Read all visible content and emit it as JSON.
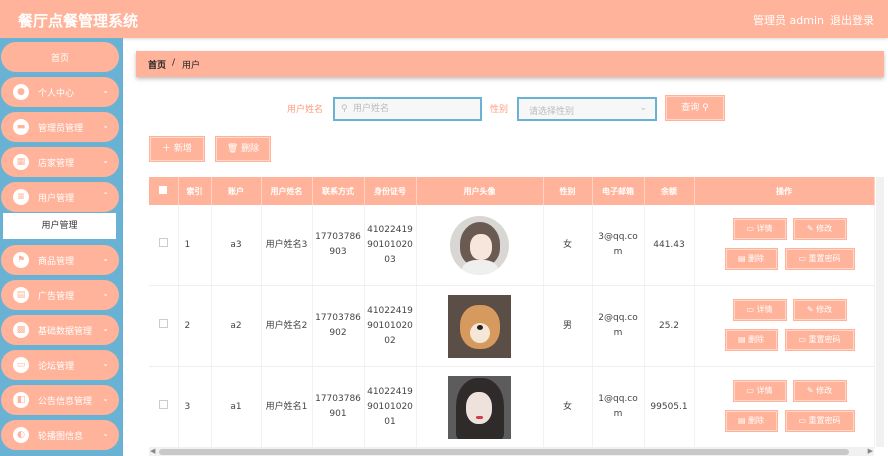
{
  "header": {
    "title": "餐厅点餐管理系统",
    "admin": "管理员 admin",
    "logout": "退出登录"
  },
  "sidebar": {
    "home": "首页",
    "items": [
      {
        "label": "个人中心",
        "icon": "user-icon"
      },
      {
        "label": "管理员管理",
        "icon": "admin-icon"
      },
      {
        "label": "店家管理",
        "icon": "store-icon"
      },
      {
        "label": "用户管理",
        "icon": "users-icon"
      },
      {
        "label": "商品管理",
        "icon": "goods-icon"
      },
      {
        "label": "广告管理",
        "icon": "ad-icon"
      },
      {
        "label": "基础数据管理",
        "icon": "grid-icon"
      },
      {
        "label": "论坛管理",
        "icon": "forum-icon"
      },
      {
        "label": "公告信息管理",
        "icon": "notice-icon"
      },
      {
        "label": "轮播图信息",
        "icon": "carousel-icon"
      }
    ],
    "active_sub": "用户管理"
  },
  "breadcrumb": {
    "home": "首页",
    "sep": "/",
    "current": "用户"
  },
  "search": {
    "name_label": "用户姓名",
    "name_placeholder": "用户姓名",
    "sex_label": "性别",
    "sex_placeholder": "请选择性别",
    "query_label": "查询"
  },
  "toolbar": {
    "add_label": "新增",
    "delete_label": "删除"
  },
  "table": {
    "headers": [
      "索引",
      "账户",
      "用户姓名",
      "联系方式",
      "身份证号",
      "用户头像",
      "性别",
      "电子邮箱",
      "余额",
      "操作"
    ],
    "rows": [
      {
        "index": "1",
        "account": "a3",
        "name": "用户姓名3",
        "phone": "17703786903",
        "idcard": "410224199010102003",
        "avatar": "avatar-illustrated-girl",
        "sex": "女",
        "email": "3@qq.com",
        "balance": "441.43"
      },
      {
        "index": "2",
        "account": "a2",
        "name": "用户姓名2",
        "phone": "17703786902",
        "idcard": "410224199010102002",
        "avatar": "avatar-shiba-dog",
        "sex": "男",
        "email": "2@qq.com",
        "balance": "25.2"
      },
      {
        "index": "3",
        "account": "a1",
        "name": "用户姓名1",
        "phone": "17703786901",
        "idcard": "410224199010102001",
        "avatar": "avatar-girl-photo",
        "sex": "女",
        "email": "1@qq.com",
        "balance": "99505.1"
      }
    ],
    "actions": {
      "detail": "详情",
      "edit": "修改",
      "delete": "删除",
      "reset": "重置密码"
    }
  },
  "colors": {
    "accent": "#ffb39a",
    "sidebar": "#6ab2d4",
    "label": "#ff9c80"
  }
}
